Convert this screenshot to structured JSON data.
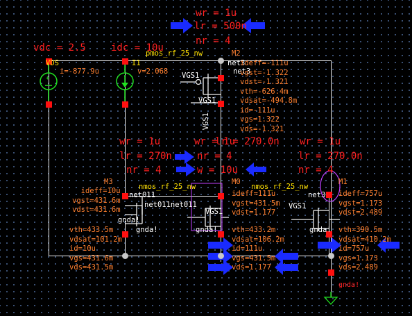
{
  "colors": {
    "background": "#000000",
    "wire": "#f0f0f0",
    "param": "#ff2020",
    "annotation": "#ff8030",
    "instance": "#ffe000",
    "net": "#ffffff",
    "source": "#20e020",
    "pin": "#ff1010",
    "arrow": "#1a2bff"
  },
  "params": {
    "m2_wr": "wr = 1u",
    "m2_lr": "lr = 500n",
    "m2_nr": "nr = 4",
    "vdc": "vdc = 2.5",
    "idc": "idc = 10u",
    "m3_wr": "wr = 1u",
    "m3_lr": "lr = 270n",
    "m3_nr": "nr = 4",
    "m0_wr": "wr = 1u",
    "m0_lr": "lr = 270.0n",
    "m0_nr": "nr = 4",
    "m0_w": "w = 10u",
    "m1_wr": "wr = 1u",
    "m1_lr": "lr = 270.0n",
    "m1_nr": "nr = 4"
  },
  "instances": {
    "vds_name": "VDS",
    "vds_i": "i=-877.9u",
    "i1_name": "I1",
    "i1_v": "v=2.068",
    "m2_cell": "pmos_rf_25_nw",
    "m2_name": "M2",
    "m3_name": "M3",
    "m0_name": "M0",
    "m1_name": "M1",
    "nmos_cell_overlap": "nmos_rf_25_nw",
    "m0_cell": "nmos_rf_25_nw"
  },
  "nets": {
    "net3_a": "net3",
    "net3_b": "net3",
    "net3_c": "net3",
    "vgs1_a": "VGS1",
    "vgs1_b": "VGS1",
    "vgs1_vert": "VGS1",
    "vgs1_c": "VGS1",
    "vgs1_d": "VGS1",
    "net011_a": "net011",
    "net011_b": "net011net011",
    "gnda_a": "gnda!",
    "gnda_b": "gnda!",
    "gnda_c": "gnda!",
    "gnda_d": "gnda!",
    "gnda_e": "gnda!"
  },
  "annotations": {
    "m2": [
      "ideff=-111u",
      "vgst=-1.322",
      "vdst=-1.321",
      "vth=-626.4m",
      "vdsat=-494.8m",
      "id=-111u",
      "vgs=1.322",
      "vds=-1.321"
    ],
    "m3": [
      "ideff=10u",
      "vgst=431.6m",
      "vdst=431.6m",
      "vth=433.5m",
      "vdsat=101.2m",
      "id=10u",
      "vgs=431.6m",
      "vds=431.5m"
    ],
    "m0": [
      "ideff=111u",
      "vgst=431.5m",
      "vdst=1.177",
      "vth=433.2m",
      "vdsat=106.2m",
      "id=111u",
      "vgs=431.5m",
      "vds=1.177"
    ],
    "m1": [
      "ideff=757u",
      "vgst=1.173",
      "vdst=2.489",
      "vth=390.5m",
      "vdsat=410.2m",
      "id=757u",
      "vgs=1.173",
      "vds=2.489"
    ]
  }
}
